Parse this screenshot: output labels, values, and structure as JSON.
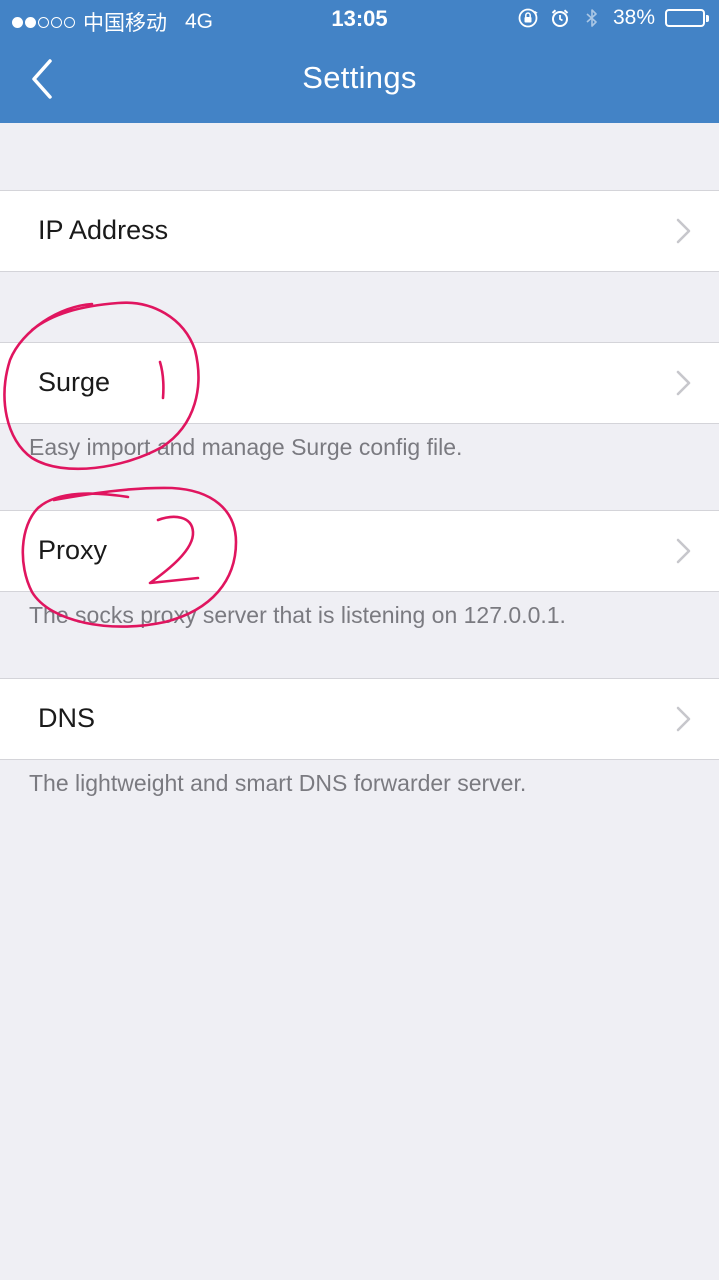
{
  "status_bar": {
    "carrier": "中国移动",
    "network": "4G",
    "time": "13:05",
    "battery_text": "38%",
    "battery_level": 0.38,
    "icons": [
      "orientation-lock-icon",
      "alarm-icon",
      "bluetooth-icon"
    ]
  },
  "nav": {
    "title": "Settings",
    "back_icon": "chevron-left-icon"
  },
  "cells": {
    "ip_address": {
      "label": "IP Address"
    },
    "surge": {
      "label": "Surge",
      "footer": "Easy import and manage Surge config file."
    },
    "proxy": {
      "label": "Proxy",
      "footer": "The socks proxy server that is listening on 127.0.0.1."
    },
    "dns": {
      "label": "DNS",
      "footer": "The lightweight and smart DNS forwarder server."
    }
  },
  "annotations": {
    "marks": [
      "1",
      "2"
    ],
    "color": "#e0155f"
  },
  "colors": {
    "nav_background": "#4383c6",
    "page_background": "#efeff4"
  }
}
